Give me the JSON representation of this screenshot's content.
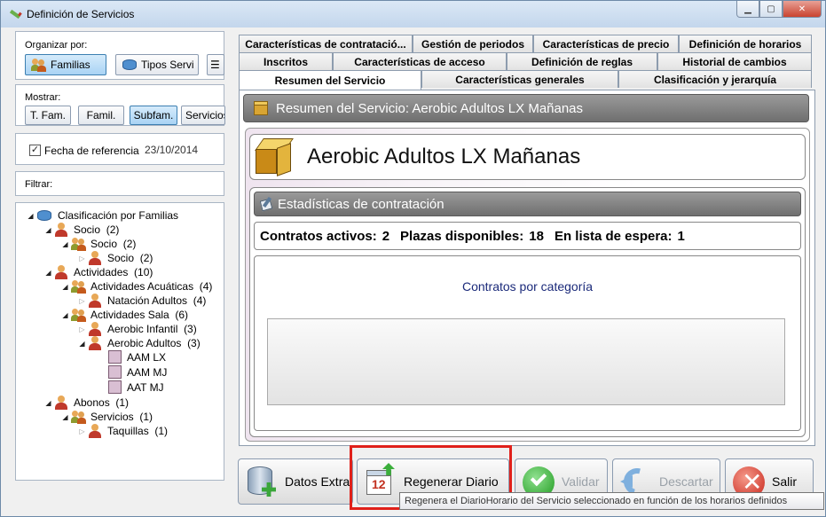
{
  "window": {
    "title": "Definición de Servicios"
  },
  "left": {
    "organize_label": "Organizar por:",
    "organize_buttons": [
      {
        "label": "Familias",
        "selected": true
      },
      {
        "label": "Tipos Servi",
        "selected": false
      }
    ],
    "show_label": "Mostrar:",
    "show_buttons": [
      {
        "label": "T. Fam.",
        "selected": false
      },
      {
        "label": "Famil.",
        "selected": false
      },
      {
        "label": "Subfam.",
        "selected": true
      },
      {
        "label": "Servicios",
        "selected": false
      }
    ],
    "ref_date_label": "Fecha de referencia",
    "ref_date_value": "23/10/2014",
    "ref_date_checked": true,
    "filter_label": "Filtrar:",
    "tree": [
      {
        "label": "Clasificación por Familias",
        "icon": "database-icon"
      },
      {
        "label": "Socio",
        "count": "(2)",
        "icon": "person-icon"
      },
      {
        "label": "Socio",
        "count": "(2)",
        "icon": "group-icon"
      },
      {
        "label": "Socio",
        "count": "(2)",
        "icon": "person-icon"
      },
      {
        "label": "Actividades",
        "count": "(10)",
        "icon": "person-icon"
      },
      {
        "label": "Actividades Acuáticas",
        "count": "(4)",
        "icon": "group-icon"
      },
      {
        "label": "Natación Adultos",
        "count": "(4)",
        "icon": "person-icon"
      },
      {
        "label": "Actividades Sala",
        "count": "(6)",
        "icon": "group-icon"
      },
      {
        "label": "Aerobic Infantil",
        "count": "(3)",
        "icon": "person-icon"
      },
      {
        "label": "Aerobic Adultos",
        "count": "(3)",
        "icon": "person-icon"
      },
      {
        "label": "AAM LX",
        "icon": "service-square-icon"
      },
      {
        "label": "AAM MJ",
        "icon": "service-square-icon"
      },
      {
        "label": "AAT MJ",
        "icon": "service-square-icon"
      },
      {
        "label": "Abonos",
        "count": "(1)",
        "icon": "person-icon"
      },
      {
        "label": "Servicios",
        "count": "(1)",
        "icon": "group-icon"
      },
      {
        "label": "Taquillas",
        "count": "(1)",
        "icon": "person-icon"
      }
    ]
  },
  "tabs": {
    "row1": [
      "Características de contratació...",
      "Gestión de periodos",
      "Características de precio",
      "Definición de horarios"
    ],
    "row2": [
      "Inscritos",
      "Características de acceso",
      "Definición de reglas",
      "Historial de cambios"
    ],
    "row3": [
      "Resumen del Servicio",
      "Características generales",
      "Clasificación y jerarquía"
    ]
  },
  "summary": {
    "header": "Resumen del Servicio: Aerobic Adultos LX Mañanas",
    "service_name": "Aerobic Adultos LX Mañanas",
    "stats_header": "Estadísticas de contratación",
    "active_label": "Contratos activos:",
    "active_value": "2",
    "places_label": "Plazas disponibles:",
    "places_value": "18",
    "waitlist_label": "En lista de espera:",
    "waitlist_value": "1",
    "chart_title": "Contratos por categoría"
  },
  "buttons": {
    "extra": "Datos Extra",
    "regen": "Regenerar Diario",
    "validate": "Validar",
    "discard": "Descartar",
    "exit": "Salir"
  },
  "tooltip": "Regenera el DiarioHorario del Servicio seleccionado en función de los horarios definidos",
  "colors": {
    "highlight": "#e0201a",
    "selected_button": "#a9d3f4"
  }
}
